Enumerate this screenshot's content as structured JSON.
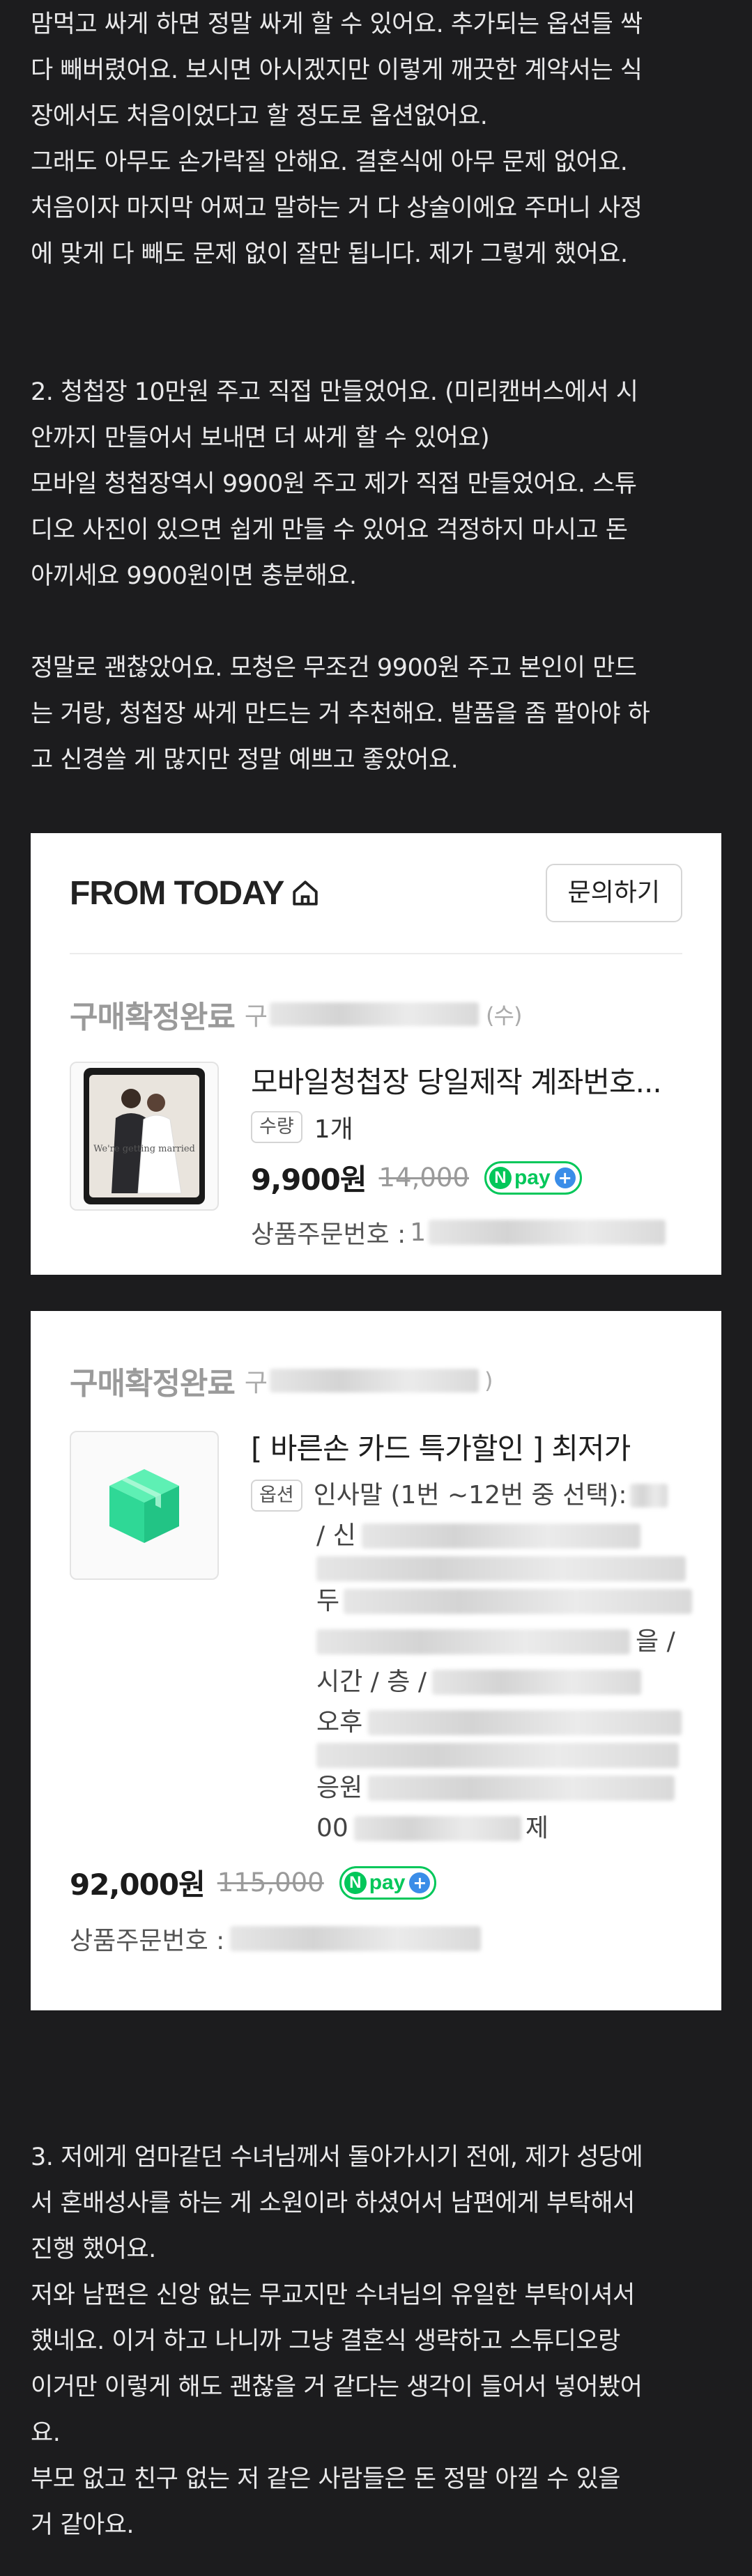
{
  "intro": {
    "lines": [
      "맘먹고 싸게 하면 정말 싸게 할 수 있어요. 추가되는 옵션들 싹",
      "다 빼버렸어요. 보시면 아시겠지만 이렇게 깨끗한 계약서는 식",
      "장에서도 처음이었다고 할 정도로 옵션없어요.",
      "그래도 아무도 손가락질 안해요. 결혼식에 아무 문제 없어요.",
      "처음이자 마지막 어쩌고 말하는 거 다 상술이에요 주머니 사정",
      "에 맞게 다 빼도 문제 없이 잘만 됩니다. 제가 그렇게 했어요."
    ]
  },
  "section2": {
    "lines": [
      "2. 청첩장 10만원 주고 직접 만들었어요. (미리캔버스에서 시",
      "안까지 만들어서 보내면 더 싸게 할 수 있어요)",
      "모바일 청첩장역시 9900원 주고 제가 직접 만들었어요. 스튜",
      "디오 사진이 있으면 쉽게 만들 수 있어요 걱정하지 마시고 돈",
      "아끼세요 9900원이면 충분해요."
    ],
    "lines2": [
      "정말로 괜찮았어요. 모청은 무조건 9900원 주고 본인이 만드",
      "는 거랑, 청첩장 싸게 만드는 거 추천해요. 발품을 좀 팔아야 하",
      "고 신경쓸 게 많지만 정말 예쁘고 좋았어요."
    ]
  },
  "order1": {
    "store_name": "FROM TODAY",
    "inquiry_label": "문의하기",
    "status": "구매확정완료",
    "status_prefix": "구",
    "status_suffix": "(수)",
    "product_name": "모바일청첩장 당일제작 계좌번호...",
    "qty_tag": "수량",
    "qty_value": "1개",
    "price": "9,900원",
    "old_price": "14,000",
    "order_no_label": "상품주문번호 :",
    "order_no_prefix": "1",
    "thumb_text": "We're getting married"
  },
  "order2": {
    "status": "구매확정완료",
    "status_prefix": "구",
    "status_suffix": ")",
    "product_name": "[ 바른손 카드 특가할인 ] 최저가",
    "option_tag": "옵션",
    "option_first_line": "인사말 (1번 ~12번 중 선택):",
    "option_partial": [
      "/ 신",
      "",
      "두",
      "",
      "시간 / 층 /",
      "오후",
      "",
      "응원",
      "00"
    ],
    "option_tail_3": "을 /",
    "option_tail_8": "제",
    "price": "92,000원",
    "old_price": "115,000",
    "order_no_label": "상품주문번호 :"
  },
  "npay": {
    "n": "N",
    "text": "pay",
    "plus": "+"
  },
  "section3": {
    "lines": [
      "3. 저에게 엄마같던 수녀님께서 돌아가시기 전에, 제가 성당에",
      "서 혼배성사를 하는 게 소원이라 하셨어서 남편에게 부탁해서",
      "진행 했어요.",
      "저와 남편은 신앙 없는 무교지만 수녀님의 유일한 부탁이셔서",
      "했네요. 이거 하고 나니까 그냥 결혼식 생략하고 스튜디오랑",
      "이거만 이렇게 해도 괜찮을 거 같다는 생각이 들어서 넣어봤어",
      "요.",
      "부모 없고 친구 없는 저 같은 사람들은 돈 정말 아낄 수 있을",
      "거 같아요."
    ]
  }
}
